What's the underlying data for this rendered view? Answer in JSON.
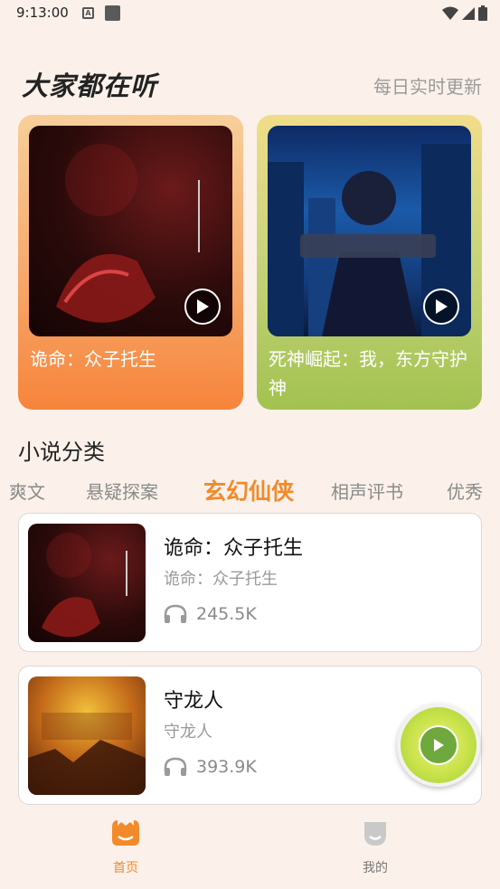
{
  "status_bar": {
    "time": "9:13:00",
    "notification_letter": "A"
  },
  "header": {
    "title": "大家都在听",
    "subtitle": "每日实时更新"
  },
  "featured": [
    {
      "title": "诡命：众子托生",
      "icon": "play-icon"
    },
    {
      "title": "死神崛起：我，东方守护神",
      "icon": "play-icon"
    }
  ],
  "categories": {
    "title": "小说分类",
    "tabs": [
      "爽文",
      "悬疑探案",
      "玄幻仙侠",
      "相声评书",
      "优秀"
    ],
    "active_tab": "玄幻仙侠"
  },
  "books": [
    {
      "title": "诡命：众子托生",
      "subtitle": "诡命：众子托生",
      "plays": "245.5K"
    },
    {
      "title": "守龙人",
      "subtitle": "守龙人",
      "plays": "393.9K"
    }
  ],
  "bottom_nav": {
    "home_label": "首页",
    "mine_label": "我的"
  },
  "colors": {
    "accent": "#f28a2b",
    "background": "#fbf1ea"
  }
}
